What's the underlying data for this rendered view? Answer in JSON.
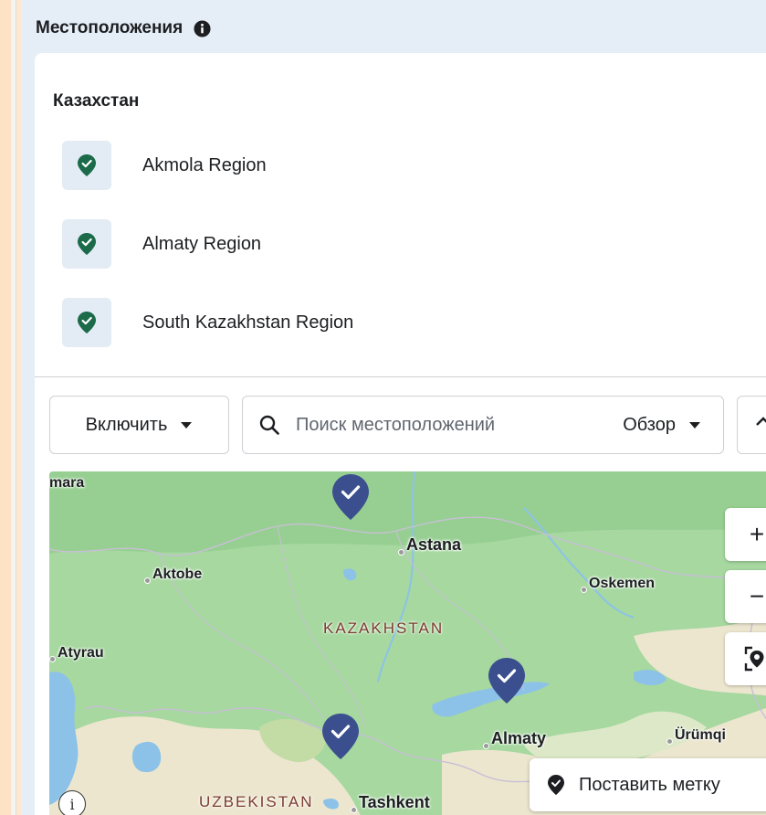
{
  "panel": {
    "title": "Местоположения",
    "info_icon": "info-circle-icon"
  },
  "country": "Казахстан",
  "regions": [
    {
      "label": "Akmola Region",
      "icon": "location-check-icon"
    },
    {
      "label": "Almaty Region",
      "icon": "location-check-icon"
    },
    {
      "label": "South Kazakhstan Region",
      "icon": "location-check-icon"
    }
  ],
  "toolbar": {
    "include_label": "Включить",
    "search_placeholder": "Поиск местоположений",
    "browse_label": "Обзор"
  },
  "map": {
    "cities": {
      "samara": "mara",
      "astana": "Astana",
      "aktobe": "Aktobe",
      "oskemen": "Oskemen",
      "atyrau": "Atyrau",
      "almaty": "Almaty",
      "urumqi": "Ürümqi",
      "tashkent": "Tashkent"
    },
    "countries": {
      "kazakhstan": "KAZAKHSTAN",
      "uzbekistan": "UZBEKISTAN"
    },
    "zoom_in": "+",
    "zoom_out": "−",
    "drop_pin_label": "Поставить метку",
    "info_glyph": "i"
  },
  "colors": {
    "pin": "#3b4f8f",
    "badge_bg": "#e3ecf4",
    "badge_icon": "#1b6b4a",
    "land_green": "#a6d8a0",
    "desert": "#ece6cf",
    "water": "#8cc2e8"
  }
}
